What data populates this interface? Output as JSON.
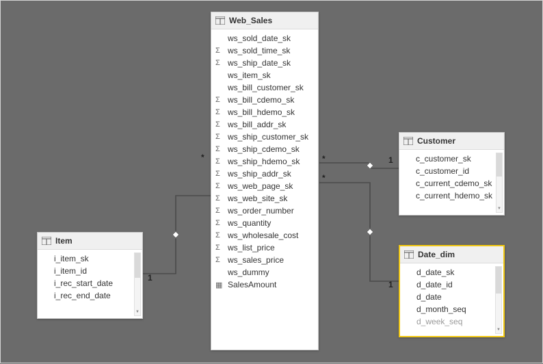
{
  "tables": {
    "item": {
      "title": "Item",
      "fields": [
        {
          "label": "i_item_sk",
          "icon": ""
        },
        {
          "label": "i_item_id",
          "icon": ""
        },
        {
          "label": "i_rec_start_date",
          "icon": ""
        },
        {
          "label": "i_rec_end_date",
          "icon": ""
        }
      ]
    },
    "web_sales": {
      "title": "Web_Sales",
      "fields": [
        {
          "label": "ws_sold_date_sk",
          "icon": ""
        },
        {
          "label": "ws_sold_time_sk",
          "icon": "Σ"
        },
        {
          "label": "ws_ship_date_sk",
          "icon": "Σ"
        },
        {
          "label": "ws_item_sk",
          "icon": ""
        },
        {
          "label": "ws_bill_customer_sk",
          "icon": ""
        },
        {
          "label": "ws_bill_cdemo_sk",
          "icon": "Σ"
        },
        {
          "label": "ws_bill_hdemo_sk",
          "icon": "Σ"
        },
        {
          "label": "ws_bill_addr_sk",
          "icon": "Σ"
        },
        {
          "label": "ws_ship_customer_sk",
          "icon": "Σ"
        },
        {
          "label": "ws_ship_cdemo_sk",
          "icon": "Σ"
        },
        {
          "label": "ws_ship_hdemo_sk",
          "icon": "Σ"
        },
        {
          "label": "ws_ship_addr_sk",
          "icon": "Σ"
        },
        {
          "label": "ws_web_page_sk",
          "icon": "Σ"
        },
        {
          "label": "ws_web_site_sk",
          "icon": "Σ"
        },
        {
          "label": "ws_order_number",
          "icon": "Σ"
        },
        {
          "label": "ws_quantity",
          "icon": "Σ"
        },
        {
          "label": "ws_wholesale_cost",
          "icon": "Σ"
        },
        {
          "label": "ws_list_price",
          "icon": "Σ"
        },
        {
          "label": "ws_sales_price",
          "icon": "Σ"
        },
        {
          "label": "ws_dummy",
          "icon": ""
        },
        {
          "label": "SalesAmount",
          "icon": "▦"
        }
      ]
    },
    "customer": {
      "title": "Customer",
      "fields": [
        {
          "label": "c_customer_sk",
          "icon": ""
        },
        {
          "label": "c_customer_id",
          "icon": ""
        },
        {
          "label": "c_current_cdemo_sk",
          "icon": ""
        },
        {
          "label": "c_current_hdemo_sk",
          "icon": ""
        }
      ]
    },
    "date_dim": {
      "title": "Date_dim",
      "fields": [
        {
          "label": "d_date_sk",
          "icon": ""
        },
        {
          "label": "d_date_id",
          "icon": ""
        },
        {
          "label": "d_date",
          "icon": ""
        },
        {
          "label": "d_month_seq",
          "icon": ""
        },
        {
          "label": "d_week_seq",
          "icon": ""
        }
      ]
    }
  },
  "relationships": {
    "item_websales": {
      "from_card": "1",
      "to_card": "*"
    },
    "customer_websales": {
      "from_card": "1",
      "to_card": "*"
    },
    "datedim_websales": {
      "from_card": "1",
      "to_card": "*"
    }
  }
}
